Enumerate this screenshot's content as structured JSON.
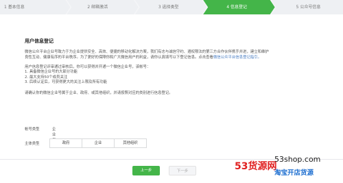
{
  "steps": [
    {
      "label": "1 基本信息"
    },
    {
      "label": "2 邮箱激活"
    },
    {
      "label": "3 选择类型"
    },
    {
      "label": "4 信息登记"
    },
    {
      "label": "5 公众号信息"
    }
  ],
  "active_step": 4,
  "colors": {
    "accent": "#44b549",
    "link": "#4a7ec2"
  },
  "section": {
    "title": "用户信息登记",
    "para1_a": "微信公众平台企业号致力于为企业提供安全、高效、便捷的移动化解决方案，我们有志与诚信守约、遵权限法的第三方合作伙伴携手并进，建立和维护",
    "para1_b": "良性互动、健康有序的平台秩序。为了更好的保障你和广大微信用户的利益，请你认真填写以下登记信息。点击查看",
    "para1_link": "微信公众平台信息登记指引。",
    "para2": "用户信息登记评审通过审核后，你可以获得并开通一个微信企业号，该帐号：",
    "list": [
      "1. 具备微信企业号的大部分功能",
      "2. 最大支持50个成员关注",
      "3. 后续认证后，可获得更大的关注上限及所有功能"
    ],
    "para3": "请确认你的微信企业号属于企业、政府、或其他组织，并请按照对应的类别进行信息登记。"
  },
  "form": {
    "account_type_label": "帐号类型",
    "account_type_value": "企业号",
    "subject_type_label": "主体类型",
    "subject_options": [
      "政府",
      "企业",
      "其他组织"
    ]
  },
  "buttons": {
    "prev": "上一步",
    "next": "下一步"
  },
  "watermark": {
    "logo": "53货源网",
    "domain": "53shop.com",
    "slogan": "淘宝开店货源"
  }
}
